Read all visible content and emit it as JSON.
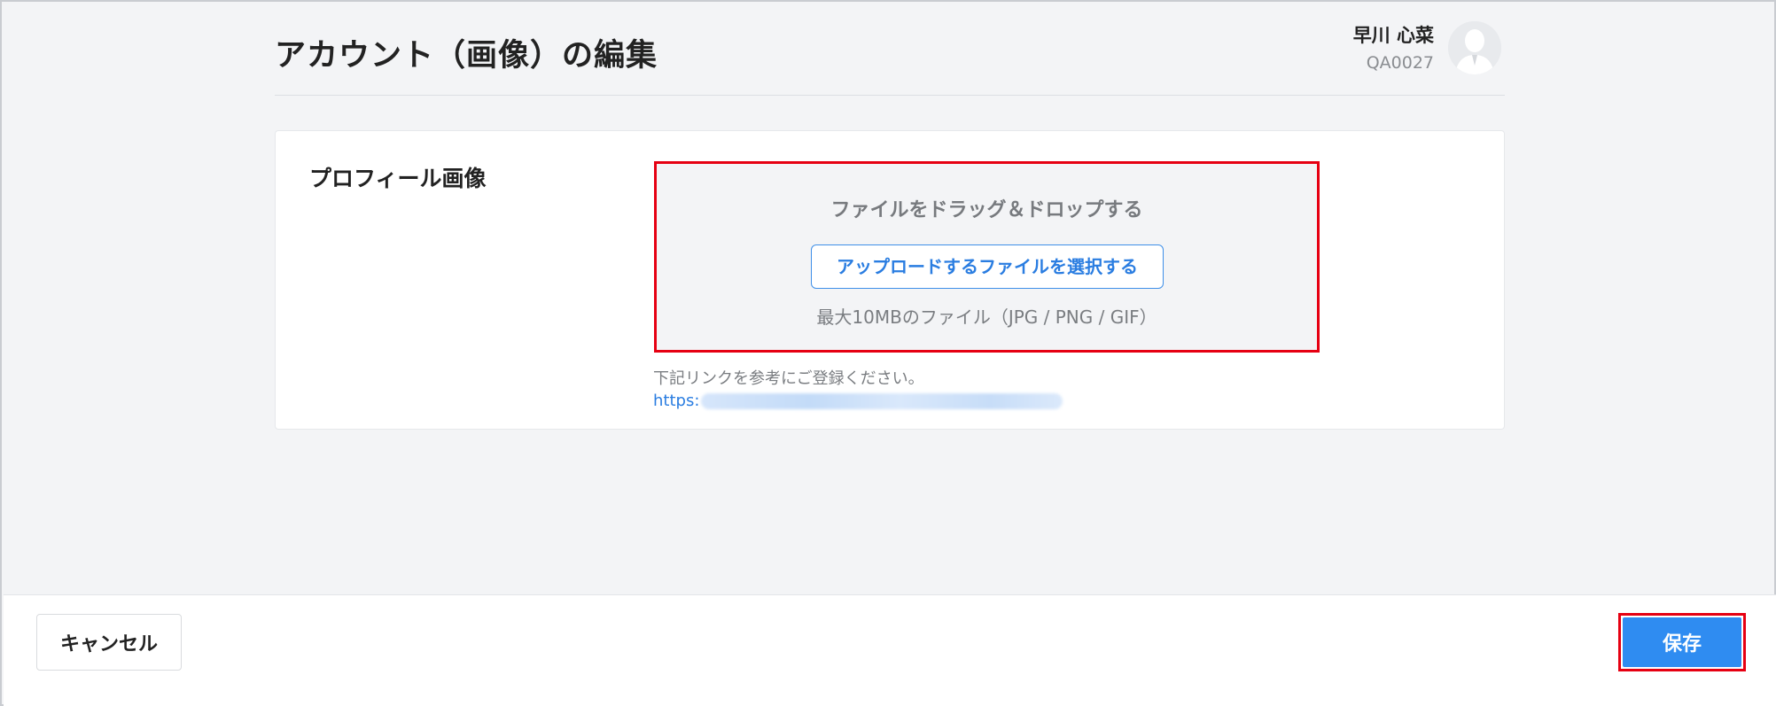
{
  "header": {
    "title": "アカウント（画像）の編集",
    "user": {
      "name": "早川 心菜",
      "code": "QA0027"
    }
  },
  "profile_image": {
    "label": "プロフィール画像",
    "dropzone": {
      "drop_text": "ファイルをドラッグ＆ドロップする",
      "upload_button": "アップロードするファイルを選択する",
      "limit_text": "最大10MBのファイル（JPG / PNG / GIF）"
    },
    "reference_note": "下記リンクを参考にご登録ください。",
    "reference_link_prefix": "https:"
  },
  "footer": {
    "cancel_label": "キャンセル",
    "save_label": "保存"
  },
  "colors": {
    "accent": "#2f8cf1",
    "highlight": "#e60012",
    "background": "#f3f4f6"
  },
  "icons": {
    "avatar": "default-user-avatar-icon"
  }
}
